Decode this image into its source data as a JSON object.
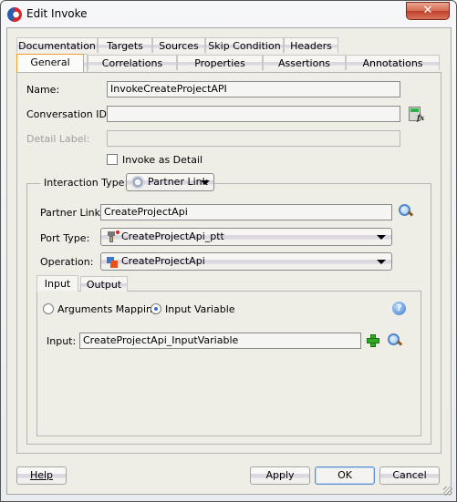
{
  "window": {
    "title": "Edit Invoke",
    "app_icon": "oracle-jdeveloper-icon",
    "close_label": "✕"
  },
  "tabs": {
    "row1": [
      {
        "label": "Documentation"
      },
      {
        "label": "Targets"
      },
      {
        "label": "Sources"
      },
      {
        "label": "Skip Condition"
      },
      {
        "label": "Headers"
      }
    ],
    "row2": [
      {
        "label": "General",
        "active": true
      },
      {
        "label": "Correlations"
      },
      {
        "label": "Properties"
      },
      {
        "label": "Assertions"
      },
      {
        "label": "Annotations"
      }
    ]
  },
  "general": {
    "name_label": "Name:",
    "name_value": "InvokeCreateProjectAPI",
    "conversation_label": "Conversation ID:",
    "conversation_value": "",
    "conversation_icon": "expression-builder-icon",
    "detail_label_label": "Detail Label:",
    "detail_label_value": "",
    "invoke_as_detail_label": "Invoke as Detail",
    "invoke_as_detail_checked": false
  },
  "interaction": {
    "label": "Interaction Type:",
    "value": "Partner Link",
    "partner_link_label": "Partner Link:",
    "partner_link_value": "CreateProjectApi",
    "port_type_label": "Port Type:",
    "port_type_value": "CreateProjectApi_ptt",
    "operation_label": "Operation:",
    "operation_value": "CreateProjectApi"
  },
  "io_tabs": [
    {
      "label": "Input",
      "active": true
    },
    {
      "label": "Output"
    }
  ],
  "input": {
    "arguments_mapping_label": "Arguments Mapping",
    "input_variable_label": "Input Variable",
    "selected": "Input Variable",
    "help_icon_label": "?",
    "input_label": "Input:",
    "input_value": "CreateProjectApi_InputVariable"
  },
  "buttons": {
    "help": "Help",
    "apply": "Apply",
    "ok": "OK",
    "cancel": "Cancel"
  }
}
